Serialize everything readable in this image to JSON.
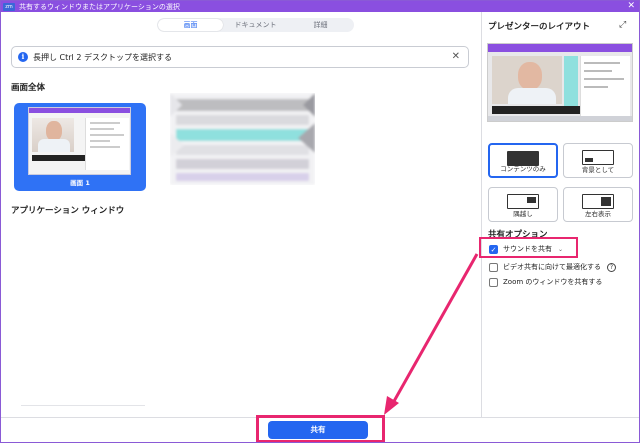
{
  "window": {
    "logo": "zm",
    "title": "共有するウィンドウまたはアプリケーションの選択",
    "close_glyph": "✕"
  },
  "tabs": [
    {
      "label": "画面",
      "active": true
    },
    {
      "label": "ドキュメント",
      "active": false
    },
    {
      "label": "詳細",
      "active": false
    }
  ],
  "info_bar": {
    "icon": "info-icon",
    "text": "長押し Ctrl 2 デスクトップを選択する",
    "close_glyph": "✕"
  },
  "sections": {
    "whole_screen": "画面全体",
    "application_window": "アプリケーション ウィンドウ"
  },
  "screen_card": {
    "label": "画面 1"
  },
  "right_panel": {
    "layout_title": "プレゼンターのレイアウト",
    "expand_icon": "expand-icon",
    "layouts": [
      {
        "label": "コンテンツのみ",
        "active": true
      },
      {
        "label": "背景として",
        "active": false
      },
      {
        "label": "隅越し",
        "active": false
      },
      {
        "label": "左右表示",
        "active": false
      }
    ],
    "share_options_title": "共有オプション",
    "options": [
      {
        "label": "サウンドを共有",
        "checked": true,
        "has_dropdown": true
      },
      {
        "label": "ビデオ共有に向けて最適化する",
        "checked": false,
        "has_help": true
      },
      {
        "label": "Zoom のウィンドウを共有する",
        "checked": false
      }
    ]
  },
  "footer": {
    "share_button": "共有"
  },
  "colors": {
    "title_bar": "#8a4fe0",
    "accent": "#2466f0",
    "highlight": "#e8266f"
  }
}
